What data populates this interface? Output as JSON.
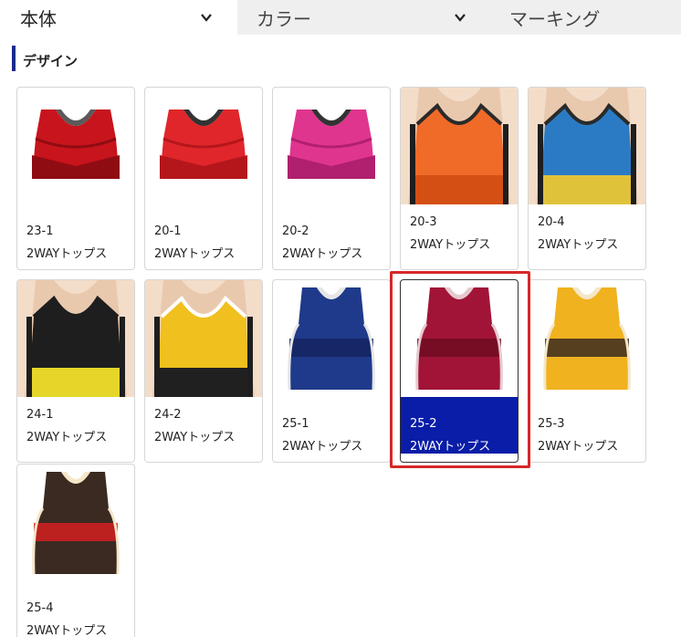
{
  "tabs": [
    {
      "label": "本体"
    },
    {
      "label": "カラー"
    },
    {
      "label": "マーキング"
    }
  ],
  "section": {
    "title": "デザイン"
  },
  "items": [
    {
      "code": "23-1",
      "name": "2WAYトップス",
      "style": "crop",
      "colors": [
        "#c8141c",
        "#8e0c12",
        "#5a5a5a"
      ],
      "selected": false
    },
    {
      "code": "20-1",
      "name": "2WAYトップス",
      "style": "crop",
      "colors": [
        "#e0262a",
        "#b4161c",
        "#333333"
      ],
      "selected": false
    },
    {
      "code": "20-2",
      "name": "2WAYトップス",
      "style": "crop",
      "colors": [
        "#e0358e",
        "#b0206e",
        "#333333"
      ],
      "selected": false
    },
    {
      "code": "20-3",
      "name": "2WAYトップス",
      "style": "model",
      "colors": [
        "#f06a28",
        "#d44f14",
        "#2a2a2a"
      ],
      "selected": false
    },
    {
      "code": "20-4",
      "name": "2WAYトップス",
      "style": "model",
      "colors": [
        "#2b7bc4",
        "#e0c23a",
        "#2a2a2a"
      ],
      "selected": false
    },
    {
      "code": "24-1",
      "name": "2WAYトップス",
      "style": "model",
      "colors": [
        "#1e1e1e",
        "#e6d62a",
        "#1e1e1e"
      ],
      "selected": false
    },
    {
      "code": "24-2",
      "name": "2WAYトップス",
      "style": "model",
      "colors": [
        "#f0c01e",
        "#202020",
        "#ffffff"
      ],
      "selected": false
    },
    {
      "code": "25-1",
      "name": "2WAYトップス",
      "style": "singlet",
      "colors": [
        "#1f3a8a",
        "#152560",
        "#e6e6e6"
      ],
      "selected": false
    },
    {
      "code": "25-2",
      "name": "2WAYトップス",
      "style": "singlet",
      "colors": [
        "#a11437",
        "#6e0c22",
        "#e6c9cf"
      ],
      "selected": true
    },
    {
      "code": "25-3",
      "name": "2WAYトップス",
      "style": "singlet",
      "colors": [
        "#f0b21e",
        "#3a2a20",
        "#f4e7c8"
      ],
      "selected": false
    },
    {
      "code": "25-4",
      "name": "2WAYトップス",
      "style": "singlet",
      "colors": [
        "#3a2a22",
        "#d41e1e",
        "#f4e7c8"
      ],
      "selected": false
    }
  ]
}
